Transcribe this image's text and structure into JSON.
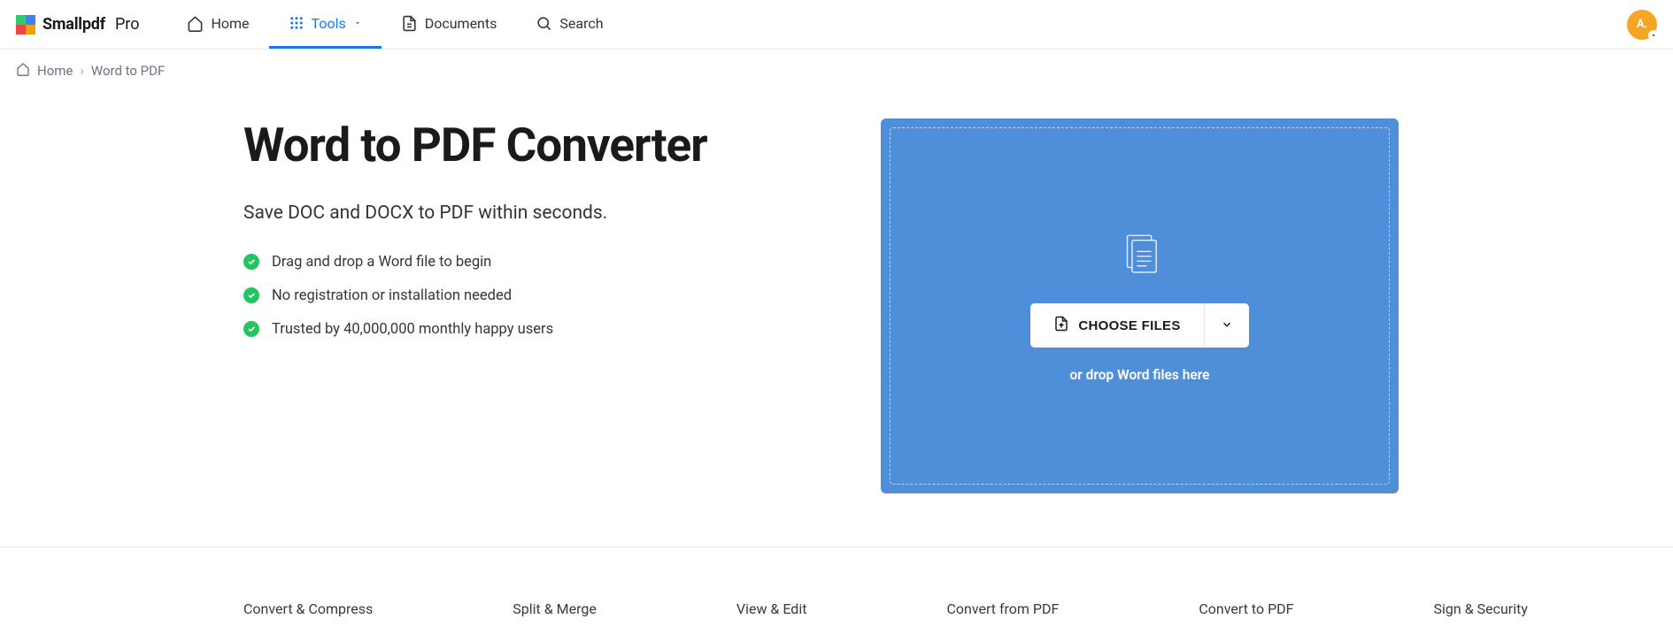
{
  "brand": {
    "name": "Smallpdf",
    "suffix": "Pro"
  },
  "nav": {
    "home": "Home",
    "tools": "Tools",
    "documents": "Documents",
    "search": "Search"
  },
  "avatar": {
    "initials": "A."
  },
  "breadcrumb": {
    "home": "Home",
    "current": "Word to PDF"
  },
  "hero": {
    "title": "Word to PDF Converter",
    "subtitle": "Save DOC and DOCX to PDF within seconds.",
    "bullets": [
      "Drag and drop a Word file to begin",
      "No registration or installation needed",
      "Trusted by 40,000,000 monthly happy users"
    ]
  },
  "dropzone": {
    "choose_label": "CHOOSE FILES",
    "hint": "or drop Word files here"
  },
  "categories": [
    "Convert & Compress",
    "Split & Merge",
    "View & Edit",
    "Convert from PDF",
    "Convert to PDF",
    "Sign & Security"
  ]
}
